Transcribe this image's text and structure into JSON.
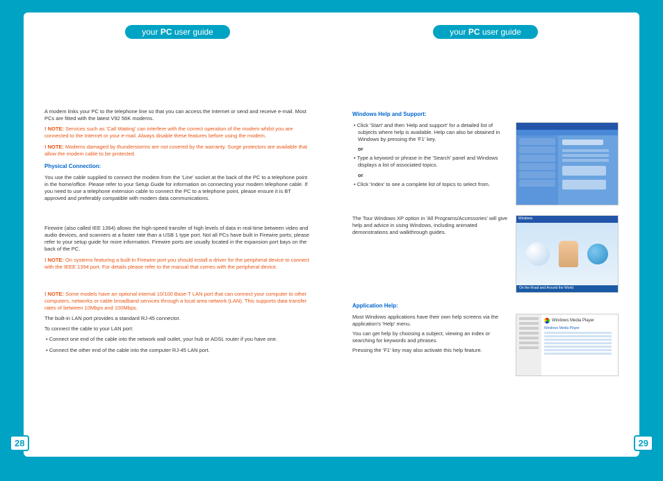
{
  "header": {
    "prefix": "your ",
    "bold": "PC",
    "suffix": " user guide"
  },
  "left": {
    "modem_intro": "A modem links your PC to the telephone line so that you can access the Internet or send and receive e-mail. Most PCs are fitted with the latest V92 56K modems.",
    "note1": "Services such as 'Call Waiting' can interfere with the correct operation of the modem whilst you are connected to the Internet or your e-mail. Always disable these features before using the modem.",
    "note2": "Modems damaged by thunderstorms are not covered by the warranty. Surge protectors are available that allow the modem cable to be protected.",
    "physical_title": "Physical Connection:",
    "physical_body": "You use the cable supplied to connect the modem from the 'Line' socket at the back of the PC to a telephone point in the home/office. Please refer to your Setup Guide for information on connecting your modem telephone cable.  If you need to use a telephone extension cable to connect the PC to a telephone point, please ensure it is BT approved and preferably compatible with modem data communications.",
    "firewire_body": "Firewire (also called IEE 1394) allows the high-speed transfer of high levels of data in real-time between video and audio devices, and scanners at a faster rate than a USB 1 type port. Not all PCs have built in Firewire ports; please refer to your setup guide for more information. Firewire ports are usually located in the expansion port bays on the back of the PC.",
    "note3": "On systems featuring a built-in Firewire port you should install a driver for the peripheral device to connect with the IEEE 1394 port. For details please refer to the manual that comes with the peripheral device.",
    "note4": "Some models have an optional internal 10/100 Base-T LAN port that can connect your computer to other computers, networks or cable broadband services through a local area network (LAN). This supports data transfer rates of between 10Mbps and 100Mbps.",
    "lan1": "The built-in LAN port provides a standard RJ-45 connector.",
    "lan2": "To connect the cable to your LAN port:",
    "lan_b1": "Connect one end of the cable into the network wall outlet, your hub or ADSL router if you have one.",
    "lan_b2": "Connect the other end of the cable into the computer RJ-45 LAN port.",
    "page_num": "28"
  },
  "right": {
    "win_help_title": "Windows Help and Support:",
    "help_b1": "Click 'Start' and then 'Help and support' for a detailed list of subjects where help is available. Help can also be obtained in Windows by pressing the 'F1' key.",
    "help_b2": "Type a keyword or phrase in the 'Search' panel and Windows displays a list of associated topics.",
    "help_b3": "Click 'Index' to see a complete list of topics to select from.",
    "or": "or",
    "tour_body": "The Tour Windows XP option in 'All Programs/Accessories' will give help and advice in using Windows, including animated demonstrations and walkthrough guides.",
    "app_title": "Application Help:",
    "app_p1": "Most Windows applications have their own help screens via the application's 'Help' menu.",
    "app_p2": "You can get help by choosing a subject, viewing an index or searching for keywords and phrases.",
    "app_p3": "Pressing the 'F1' key may also activate this help feature.",
    "thumb_tour_title": "Windows",
    "thumb_tour_footer": "On the Road and Around the World",
    "thumb_app_title": "Windows Media Player",
    "page_num": "29"
  },
  "note_label": "! NOTE: "
}
